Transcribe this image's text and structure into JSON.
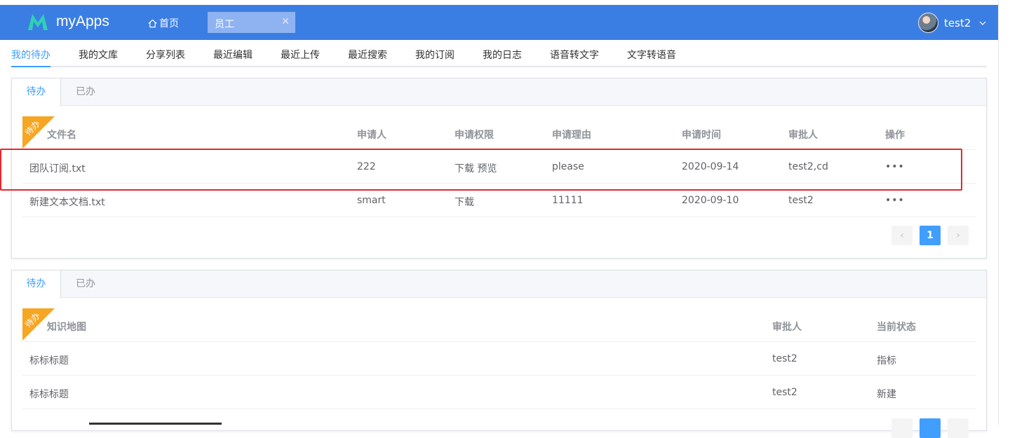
{
  "header": {
    "app_name": "myApps",
    "home_label": "首页",
    "open_tab": "员工",
    "close_glyph": "✕",
    "user_name": "test2",
    "brand_color": "#3b7ee3"
  },
  "subnav": {
    "items": [
      "我的待办",
      "我的文库",
      "分享列表",
      "最近编辑",
      "最近上传",
      "最近搜索",
      "我的订阅",
      "我的日志",
      "语音转文字",
      "文字转语音"
    ],
    "active_index": 0
  },
  "card1": {
    "tabs": [
      "待办",
      "已办"
    ],
    "ribbon": "待办",
    "columns": [
      "文件名",
      "申请人",
      "申请权限",
      "申请理由",
      "申请时间",
      "审批人",
      "操作"
    ],
    "rows": [
      [
        "团队订阅.txt",
        "222",
        "下载 预览",
        "please",
        "2020-09-14",
        "test2,cd",
        "•••"
      ],
      [
        "新建文本文档.txt",
        "smart",
        "下载",
        "11111",
        "2020-09-10",
        "test2",
        "•••"
      ]
    ],
    "pager": {
      "prev": "‹",
      "page": "1",
      "next": "›"
    },
    "highlighted_row": 0
  },
  "card2": {
    "tabs": [
      "待办",
      "已办"
    ],
    "ribbon": "待办",
    "columns": [
      "知识地图",
      "审批人",
      "当前状态"
    ],
    "rows": [
      [
        "标标标题",
        "test2",
        "指标"
      ],
      [
        "标标标题",
        "test2",
        "新建"
      ]
    ]
  }
}
